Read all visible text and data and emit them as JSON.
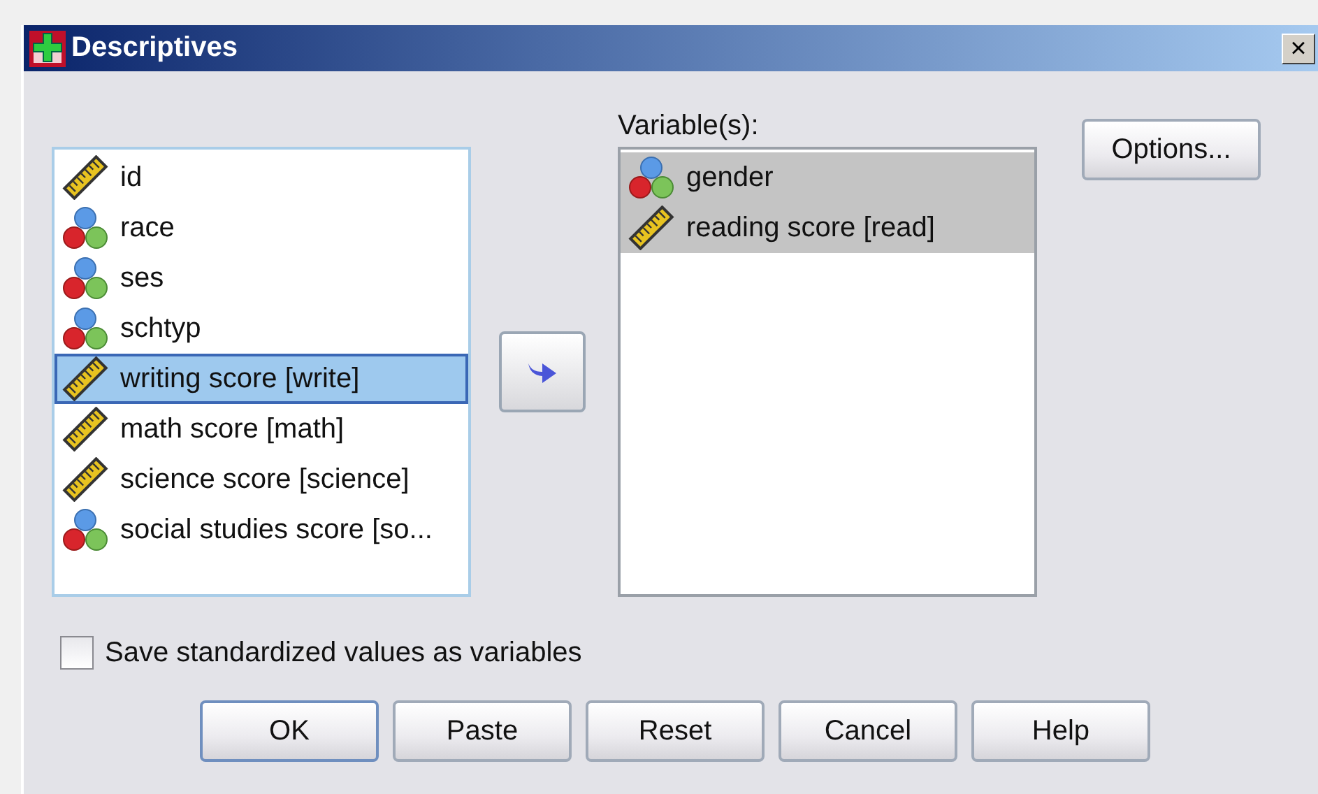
{
  "window": {
    "title": "Descriptives",
    "close": "×"
  },
  "source_list": {
    "items": [
      {
        "kind": "scale",
        "label": "id",
        "selected": false
      },
      {
        "kind": "nominal",
        "label": "race",
        "selected": false
      },
      {
        "kind": "nominal",
        "label": "ses",
        "selected": false
      },
      {
        "kind": "nominal",
        "label": "schtyp",
        "selected": false
      },
      {
        "kind": "scale",
        "label": "writing score [write]",
        "selected": true
      },
      {
        "kind": "scale",
        "label": "math score [math]",
        "selected": false
      },
      {
        "kind": "scale",
        "label": "science score [science]",
        "selected": false
      },
      {
        "kind": "nominal",
        "label": "social studies score [so...",
        "selected": false
      }
    ]
  },
  "variables": {
    "label": "Variable(s):",
    "items": [
      {
        "kind": "nominal",
        "label": "gender",
        "selected": true
      },
      {
        "kind": "scale",
        "label": "reading score [read]",
        "selected": true
      }
    ]
  },
  "options_button": "Options...",
  "save_checkbox": {
    "label": "Save standardized values as variables",
    "checked": false
  },
  "buttons": [
    {
      "label": "OK",
      "default": true
    },
    {
      "label": "Paste",
      "default": false
    },
    {
      "label": "Reset",
      "default": false
    },
    {
      "label": "Cancel",
      "default": false
    },
    {
      "label": "Help",
      "default": false
    }
  ]
}
